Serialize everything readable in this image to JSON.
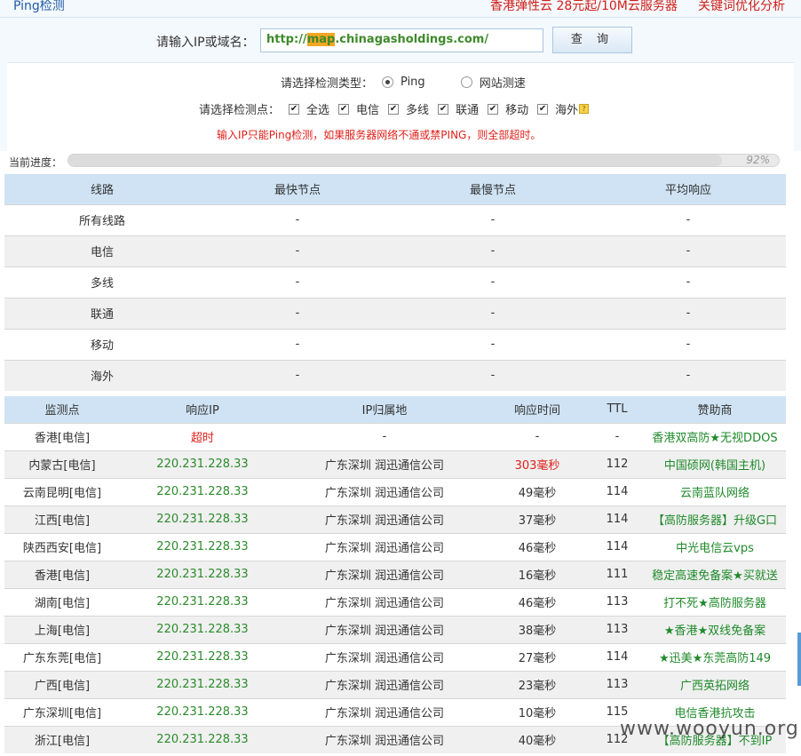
{
  "topbar": {
    "title": "Ping检测",
    "ad1": "香港弹性云 28元起/10M云服务器",
    "ad2": "关键词优化分析"
  },
  "form": {
    "ip_label": "请输入IP或域名：",
    "ip_value_prefix": "http://",
    "ip_value_highlight": "map",
    "ip_value_suffix": ".chinagasholdings.com/",
    "query_button": "查 询",
    "type_label": "请选择检测类型：",
    "type_options": [
      {
        "label": "Ping",
        "checked": true
      },
      {
        "label": "网站测速",
        "checked": false
      }
    ],
    "node_label": "请选择检测点：",
    "node_options": [
      {
        "label": "全选",
        "checked": true
      },
      {
        "label": "电信",
        "checked": true
      },
      {
        "label": "多线",
        "checked": true
      },
      {
        "label": "联通",
        "checked": true
      },
      {
        "label": "移动",
        "checked": true
      },
      {
        "label": "海外",
        "checked": true
      }
    ],
    "warning": "输入IP只能Ping检测，如果服务器网络不通或禁PING，则全部超时。"
  },
  "progress": {
    "label": "当前进度：",
    "value": 0.92,
    "text": "92%"
  },
  "summary": {
    "headers": [
      "线路",
      "最快节点",
      "最慢节点",
      "平均响应"
    ],
    "rows": [
      [
        "所有线路",
        "-",
        "-",
        "-"
      ],
      [
        "电信",
        "-",
        "-",
        "-"
      ],
      [
        "多线",
        "-",
        "-",
        "-"
      ],
      [
        "联通",
        "-",
        "-",
        "-"
      ],
      [
        "移动",
        "-",
        "-",
        "-"
      ],
      [
        "海外",
        "-",
        "-",
        "-"
      ]
    ]
  },
  "details": {
    "headers": [
      "监测点",
      "响应IP",
      "IP归属地",
      "响应时间",
      "TTL",
      "赞助商"
    ],
    "rows": [
      {
        "node": "香港[电信]",
        "ip": "超时",
        "ip_timeout": true,
        "location": "-",
        "time": "-",
        "time_red": false,
        "ttl": "-",
        "sponsor": "香港双高防★无视DDOS"
      },
      {
        "node": "内蒙古[电信]",
        "ip": "220.231.228.33",
        "ip_timeout": false,
        "location": "广东深圳 润迅通信公司",
        "time": "303毫秒",
        "time_red": true,
        "ttl": "112",
        "sponsor": "中国硕网(韩国主机)"
      },
      {
        "node": "云南昆明[电信]",
        "ip": "220.231.228.33",
        "ip_timeout": false,
        "location": "广东深圳 润迅通信公司",
        "time": "49毫秒",
        "time_red": false,
        "ttl": "114",
        "sponsor": "云南蓝队网络"
      },
      {
        "node": "江西[电信]",
        "ip": "220.231.228.33",
        "ip_timeout": false,
        "location": "广东深圳 润迅通信公司",
        "time": "37毫秒",
        "time_red": false,
        "ttl": "114",
        "sponsor": "【高防服务器】升级G口"
      },
      {
        "node": "陕西西安[电信]",
        "ip": "220.231.228.33",
        "ip_timeout": false,
        "location": "广东深圳 润迅通信公司",
        "time": "46毫秒",
        "time_red": false,
        "ttl": "114",
        "sponsor": "中光电信云vps"
      },
      {
        "node": "香港[电信]",
        "ip": "220.231.228.33",
        "ip_timeout": false,
        "location": "广东深圳 润迅通信公司",
        "time": "16毫秒",
        "time_red": false,
        "ttl": "111",
        "sponsor": "稳定高速免备案★买就送"
      },
      {
        "node": "湖南[电信]",
        "ip": "220.231.228.33",
        "ip_timeout": false,
        "location": "广东深圳 润迅通信公司",
        "time": "46毫秒",
        "time_red": false,
        "ttl": "113",
        "sponsor": "打不死★高防服务器"
      },
      {
        "node": "上海[电信]",
        "ip": "220.231.228.33",
        "ip_timeout": false,
        "location": "广东深圳 润迅通信公司",
        "time": "38毫秒",
        "time_red": false,
        "ttl": "113",
        "sponsor": "★香港★双线免备案"
      },
      {
        "node": "广东东莞[电信]",
        "ip": "220.231.228.33",
        "ip_timeout": false,
        "location": "广东深圳 润迅通信公司",
        "time": "27毫秒",
        "time_red": false,
        "ttl": "114",
        "sponsor": "★迅美★东莞高防149"
      },
      {
        "node": "广西[电信]",
        "ip": "220.231.228.33",
        "ip_timeout": false,
        "location": "广东深圳 润迅通信公司",
        "time": "23毫秒",
        "time_red": false,
        "ttl": "113",
        "sponsor": "广西英拓网络"
      },
      {
        "node": "广东深圳[电信]",
        "ip": "220.231.228.33",
        "ip_timeout": false,
        "location": "广东深圳 润迅通信公司",
        "time": "10毫秒",
        "time_red": false,
        "ttl": "115",
        "sponsor": "电信香港抗攻击"
      },
      {
        "node": "浙江[电信]",
        "ip": "220.231.228.33",
        "ip_timeout": false,
        "location": "广东深圳 润迅通信公司",
        "time": "40毫秒",
        "time_red": false,
        "ttl": "112",
        "sponsor": "【高防服务器】不到IP"
      }
    ]
  },
  "watermark": "www.wooyun.org"
}
